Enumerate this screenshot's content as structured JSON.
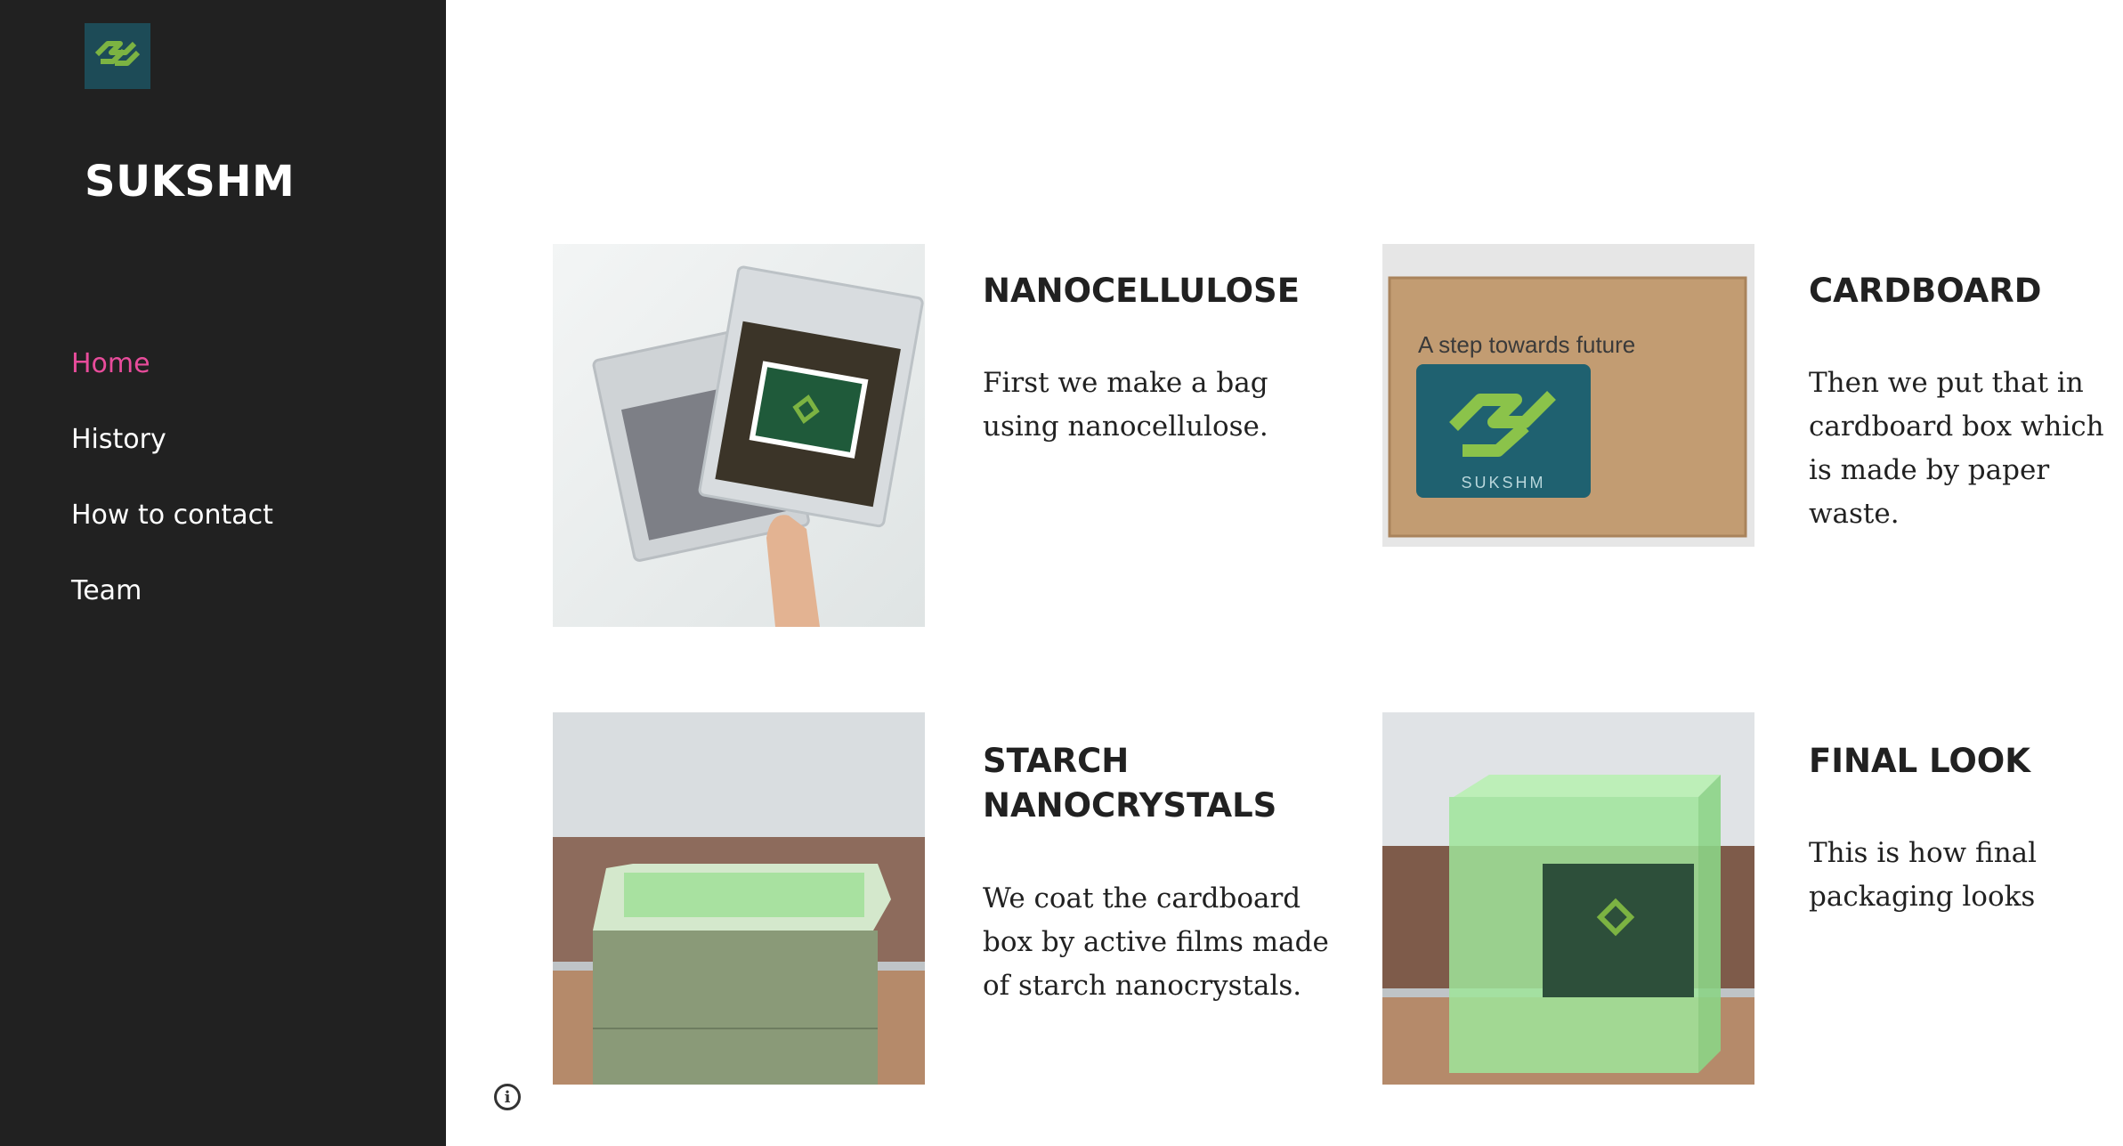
{
  "site": {
    "title": "SUKSHM"
  },
  "nav": {
    "items": [
      {
        "label": "Home",
        "active": true
      },
      {
        "label": "History",
        "active": false
      },
      {
        "label": "How to contact",
        "active": false
      },
      {
        "label": "Team",
        "active": false
      }
    ]
  },
  "cards": [
    {
      "title": "NANOCELLULOSE",
      "text": "First we make a bag using nanocellulose.",
      "image": "nanocellulose-bag-photo"
    },
    {
      "title": "CARDBOARD",
      "text": "Then we put that in cardboard box which is made by paper waste.",
      "image": "cardboard-box-photo",
      "image_caption": "A step towards future",
      "image_logo_text": "SUKSHM"
    },
    {
      "title": "STARCH NANOCRYSTALS",
      "text": "We coat the cardboard box by active films made of starch nanocrystals.",
      "image": "coated-box-photo"
    },
    {
      "title": "FINAL LOOK",
      "text": "This is how final packaging looks",
      "image": "final-packaging-photo"
    }
  ],
  "colors": {
    "sidebar": "#212121",
    "nav_active": "#e84c9b",
    "logo_bg": "#1d4b57",
    "logo_green": "#7cb342"
  },
  "icons": {
    "info": "info-icon"
  }
}
